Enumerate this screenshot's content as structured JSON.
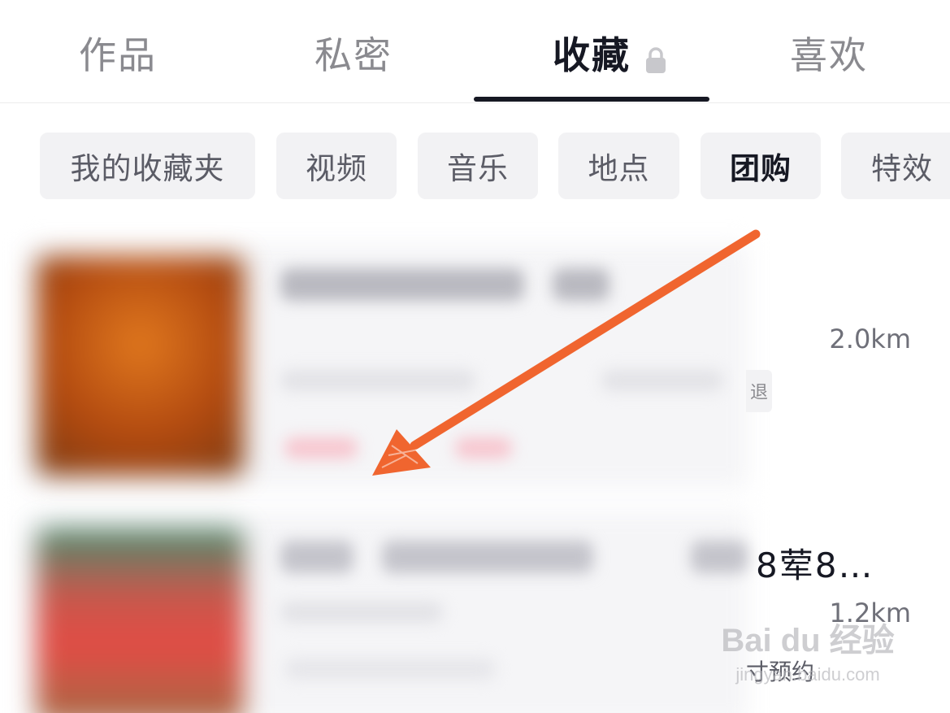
{
  "tabs": {
    "items": [
      {
        "label": "作品"
      },
      {
        "label": "私密"
      },
      {
        "label": "收藏"
      },
      {
        "label": "喜欢"
      }
    ],
    "active_index": 2
  },
  "filters": {
    "items": [
      {
        "label": "我的收藏夹"
      },
      {
        "label": "视频"
      },
      {
        "label": "音乐"
      },
      {
        "label": "地点"
      },
      {
        "label": "团购"
      },
      {
        "label": "特效"
      }
    ],
    "active_index": 4
  },
  "list": {
    "items": [
      {
        "distance": "2.0km",
        "tag_tail": "退"
      },
      {
        "distance": "1.2km",
        "title_tail": "8荤8…",
        "booking_tail": "寸预约"
      }
    ]
  },
  "annotation": {
    "arrow_color": "#f0652f"
  },
  "watermark": {
    "main": "Bai du 经验",
    "sub": "jingyan.baidu.com"
  },
  "colors": {
    "active_text": "#161823",
    "inactive_text": "#8a8a8f",
    "chip_bg": "#f2f2f4"
  }
}
